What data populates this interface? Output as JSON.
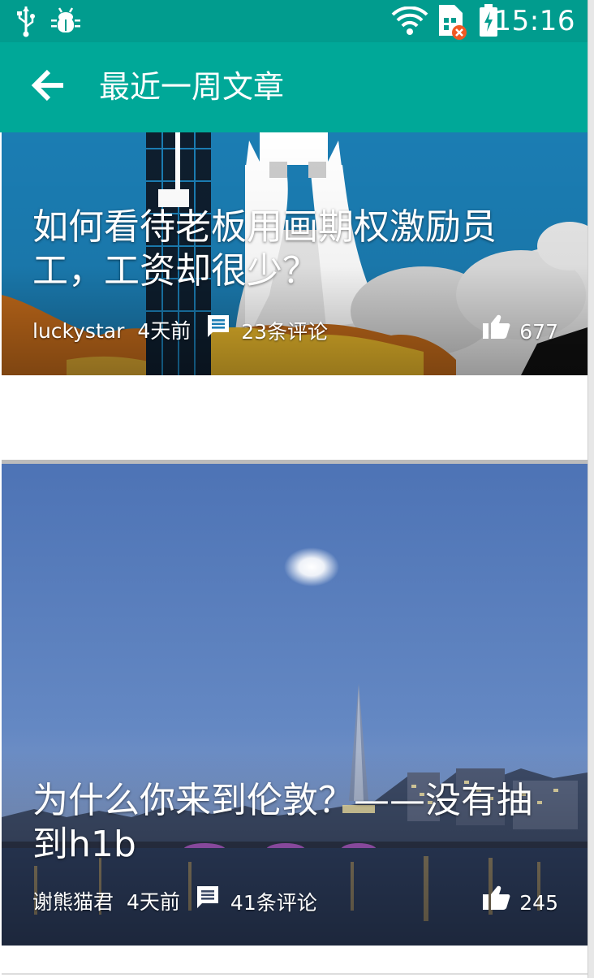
{
  "status_bar": {
    "time": "15:16",
    "icons": [
      "usb-icon",
      "android-debug-icon",
      "wifi-icon",
      "sim-no-service-icon",
      "battery-charging-icon"
    ]
  },
  "toolbar": {
    "back_icon": "arrow-left-icon",
    "title": "最近一周文章"
  },
  "articles": [
    {
      "title": "如何看待老板用画期权激励员工，工资却很少？",
      "author": "luckystar",
      "time": "4天前",
      "comments": "23条评论",
      "likes": "677",
      "image": "rocket-launch-illustration"
    },
    {
      "title": "为什么你来到伦敦？——没有抽到h1b",
      "author": "谢熊猫君",
      "time": "4天前",
      "comments": "41条评论",
      "likes": "245",
      "image": "london-skyline-night-photo"
    }
  ],
  "colors": {
    "status_bar": "#019C8E",
    "toolbar": "#00A898",
    "text_on_primary": "#FFFFFF"
  }
}
